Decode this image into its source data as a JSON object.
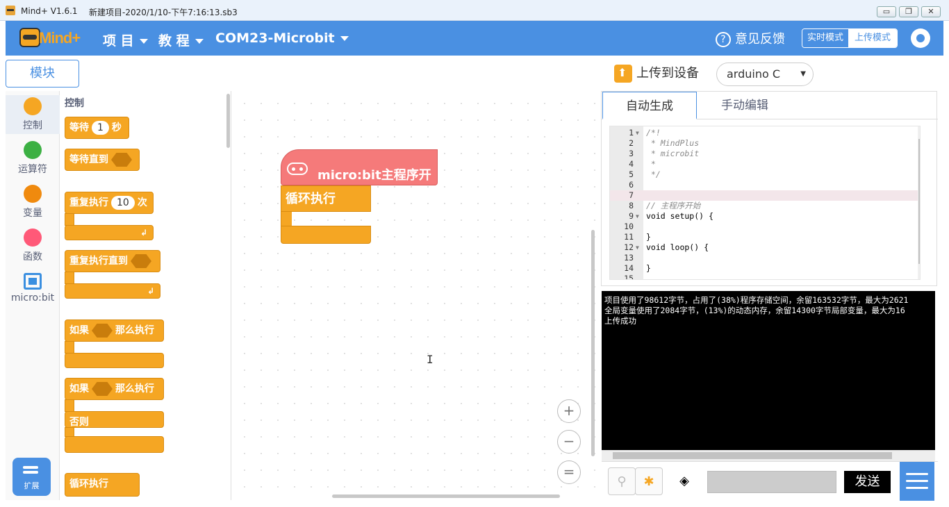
{
  "titlebar": {
    "app_name": "Mind+ V1.6.1",
    "file_name": "新建项目-2020/1/10-下午7:16:13.sb3",
    "minimize": "▭",
    "restore": "❐",
    "close": "✕"
  },
  "menubar": {
    "logo": "Mind+",
    "items": [
      {
        "label": "项 目"
      },
      {
        "label": "教 程"
      },
      {
        "label": "COM23-Microbit"
      }
    ],
    "feedback": "意见反馈",
    "mode_realtime": "实时模式",
    "mode_upload": "上传模式"
  },
  "blocks_tab": "模块",
  "categories": [
    {
      "label": "控制",
      "color": "#f5a623"
    },
    {
      "label": "运算符",
      "color": "#3cb043"
    },
    {
      "label": "变量",
      "color": "#f08a0e"
    },
    {
      "label": "函数",
      "color": "#ff5978"
    },
    {
      "label": "micro:bit",
      "color": "#3a8fe0"
    }
  ],
  "extension_label": "扩展",
  "palette": {
    "title": "控制",
    "wait_label": "等待",
    "wait_value": "1",
    "wait_unit": "秒",
    "wait_until_label": "等待直到",
    "repeat_label": "重复执行",
    "repeat_value": "10",
    "repeat_unit": "次",
    "repeat_until_label": "重复执行直到",
    "if_label": "如果",
    "then_label": "那么执行",
    "if2_label": "如果",
    "then2_label": "那么执行",
    "else_label": "否则",
    "forever_label": "循环执行"
  },
  "workspace": {
    "hat_label": "micro:bit主程序开始",
    "loop_label": "循环执行",
    "zoom_in": "+",
    "zoom_out": "−",
    "zoom_reset": "="
  },
  "upload": {
    "label": "上传到设备",
    "language": "arduino C"
  },
  "code_tabs": [
    "自动生成",
    "手动编辑"
  ],
  "code_lines": [
    {
      "n": "1",
      "text": "/*!",
      "comment": true,
      "fold": true
    },
    {
      "n": "2",
      "text": " * MindPlus",
      "comment": true
    },
    {
      "n": "3",
      "text": " * microbit",
      "comment": true
    },
    {
      "n": "4",
      "text": " *",
      "comment": true
    },
    {
      "n": "5",
      "text": " */",
      "comment": true
    },
    {
      "n": "6",
      "text": ""
    },
    {
      "n": "7",
      "text": "",
      "highlight": true
    },
    {
      "n": "8",
      "text": "// 主程序开始",
      "comment": true
    },
    {
      "n": "9",
      "text": "void setup() {",
      "fold": true
    },
    {
      "n": "10",
      "text": ""
    },
    {
      "n": "11",
      "text": "}"
    },
    {
      "n": "12",
      "text": "void loop() {",
      "fold": true
    },
    {
      "n": "13",
      "text": ""
    },
    {
      "n": "14",
      "text": "}"
    },
    {
      "n": "15",
      "text": ""
    }
  ],
  "console_lines": [
    "项目使用了98612字节，占用了(38%)程序存储空间，余留163532字节，最大为2621",
    "全局变量使用了2084字节，(13%)的动态内存，余留14300字节局部变量，最大为16",
    "上传成功"
  ],
  "serial": {
    "send": "发送",
    "input_value": ""
  }
}
